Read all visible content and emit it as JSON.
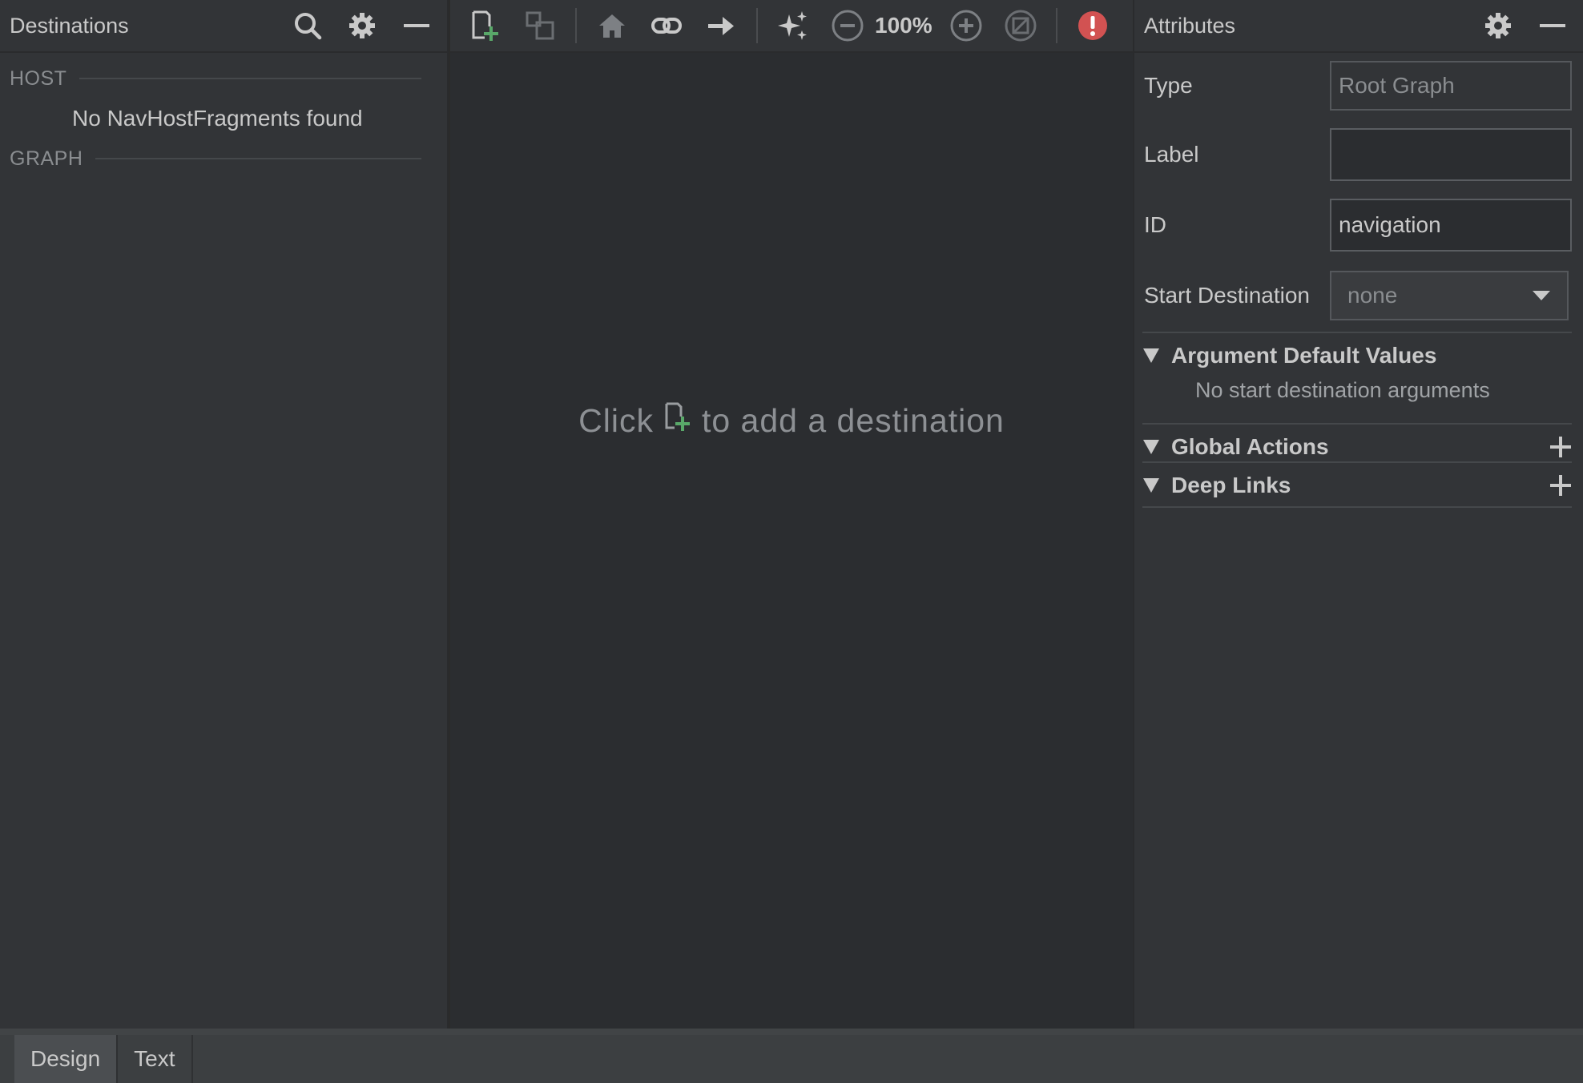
{
  "destinations": {
    "title": "Destinations",
    "host_section": "HOST",
    "host_empty": "No NavHostFragments found",
    "graph_section": "GRAPH"
  },
  "toolbar": {
    "zoom": "100%"
  },
  "canvas": {
    "hint_before": "Click",
    "hint_after": "to add a destination"
  },
  "attributes": {
    "title": "Attributes",
    "type_label": "Type",
    "type_value": "Root Graph",
    "label_label": "Label",
    "label_value": "",
    "id_label": "ID",
    "id_value": "navigation",
    "start_label": "Start Destination",
    "start_value": "none",
    "groups": [
      {
        "title": "Argument Default Values",
        "note": "No start destination arguments"
      },
      {
        "title": "Global Actions"
      },
      {
        "title": "Deep Links"
      }
    ]
  },
  "tabs": [
    {
      "label": "Design"
    },
    {
      "label": "Text"
    }
  ],
  "colors": {
    "accent_green": "#59a869",
    "error_red": "#d25252"
  }
}
